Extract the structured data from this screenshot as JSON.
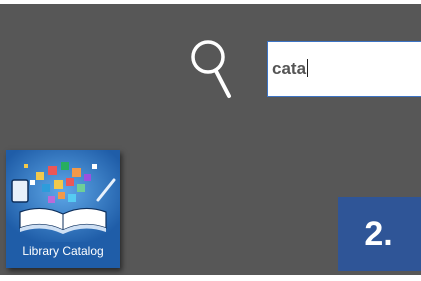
{
  "search": {
    "query": "cata",
    "icon": "magnifier-icon",
    "accent_color": "#3d74c4"
  },
  "tiles": [
    {
      "label": "Library Catalog",
      "icon": "open-book-icon",
      "background_color": "#1f5da8"
    }
  ],
  "step_badge": {
    "text": "2.",
    "color": "#2f5597"
  },
  "colors": {
    "panel_background": "#575757"
  }
}
